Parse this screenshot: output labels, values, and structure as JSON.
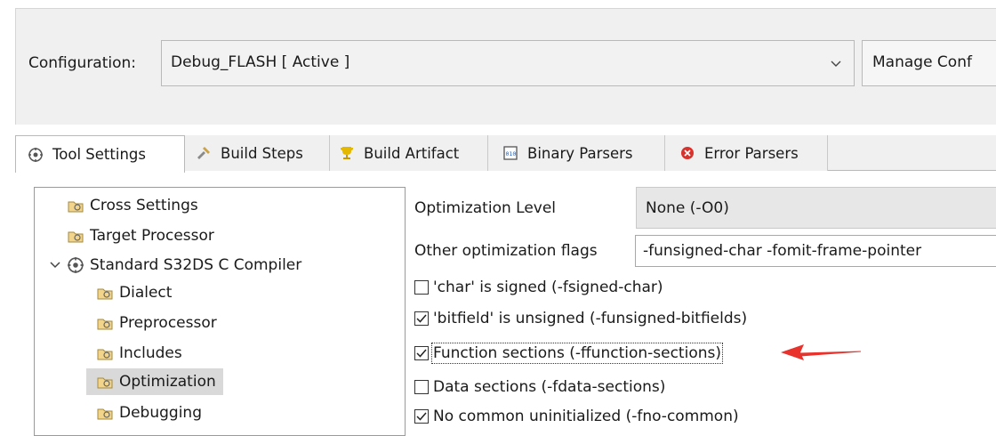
{
  "configuration": {
    "label": "Configuration:",
    "value": "Debug_FLASH  [ Active ]",
    "manage_label": "Manage Conf"
  },
  "tabs": [
    {
      "label": "Tool Settings",
      "icon": "tool-settings-icon",
      "active": true
    },
    {
      "label": "Build Steps",
      "icon": "build-steps-icon",
      "active": false
    },
    {
      "label": "Build Artifact",
      "icon": "build-artifact-icon",
      "active": false
    },
    {
      "label": "Binary Parsers",
      "icon": "binary-parsers-icon",
      "active": false
    },
    {
      "label": "Error Parsers",
      "icon": "error-parsers-icon",
      "active": false
    }
  ],
  "tree": {
    "items": [
      {
        "label": "Cross Settings"
      },
      {
        "label": "Target Processor"
      },
      {
        "label": "Standard S32DS C Compiler",
        "expanded": true
      },
      {
        "label": "Dialect"
      },
      {
        "label": "Preprocessor"
      },
      {
        "label": "Includes"
      },
      {
        "label": "Optimization",
        "selected": true
      },
      {
        "label": "Debugging"
      }
    ]
  },
  "options": {
    "opt_level_label": "Optimization Level",
    "opt_level_value": "None (-O0)",
    "other_flags_label": "Other optimization flags",
    "other_flags_value": "-funsigned-char -fomit-frame-pointer",
    "checks": [
      {
        "label": "'char' is signed (-fsigned-char)",
        "checked": false
      },
      {
        "label": "'bitfield' is unsigned (-funsigned-bitfields)",
        "checked": true
      },
      {
        "label": "Function sections (-ffunction-sections)",
        "checked": true
      },
      {
        "label": "Data sections (-fdata-sections)",
        "checked": false
      },
      {
        "label": "No common uninitialized (-fno-common)",
        "checked": true
      }
    ]
  },
  "colors": {
    "annotation_arrow": "#e8322b",
    "selection": "#d9d9d9"
  }
}
